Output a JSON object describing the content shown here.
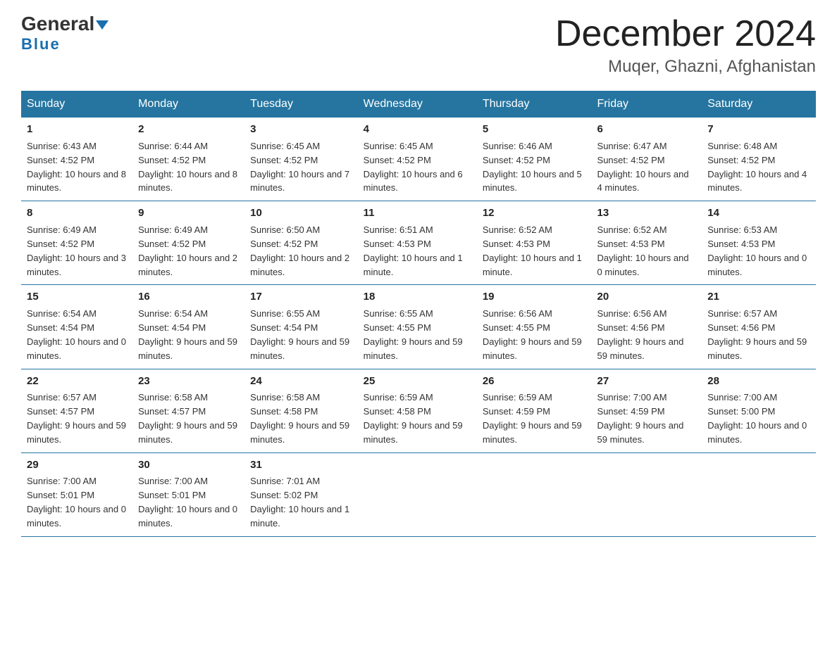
{
  "logo": {
    "general": "General",
    "blue": "Blue"
  },
  "title": "December 2024",
  "subtitle": "Muqer, Ghazni, Afghanistan",
  "days_header": [
    "Sunday",
    "Monday",
    "Tuesday",
    "Wednesday",
    "Thursday",
    "Friday",
    "Saturday"
  ],
  "weeks": [
    [
      {
        "num": "1",
        "sunrise": "6:43 AM",
        "sunset": "4:52 PM",
        "daylight": "10 hours and 8 minutes."
      },
      {
        "num": "2",
        "sunrise": "6:44 AM",
        "sunset": "4:52 PM",
        "daylight": "10 hours and 8 minutes."
      },
      {
        "num": "3",
        "sunrise": "6:45 AM",
        "sunset": "4:52 PM",
        "daylight": "10 hours and 7 minutes."
      },
      {
        "num": "4",
        "sunrise": "6:45 AM",
        "sunset": "4:52 PM",
        "daylight": "10 hours and 6 minutes."
      },
      {
        "num": "5",
        "sunrise": "6:46 AM",
        "sunset": "4:52 PM",
        "daylight": "10 hours and 5 minutes."
      },
      {
        "num": "6",
        "sunrise": "6:47 AM",
        "sunset": "4:52 PM",
        "daylight": "10 hours and 4 minutes."
      },
      {
        "num": "7",
        "sunrise": "6:48 AM",
        "sunset": "4:52 PM",
        "daylight": "10 hours and 4 minutes."
      }
    ],
    [
      {
        "num": "8",
        "sunrise": "6:49 AM",
        "sunset": "4:52 PM",
        "daylight": "10 hours and 3 minutes."
      },
      {
        "num": "9",
        "sunrise": "6:49 AM",
        "sunset": "4:52 PM",
        "daylight": "10 hours and 2 minutes."
      },
      {
        "num": "10",
        "sunrise": "6:50 AM",
        "sunset": "4:52 PM",
        "daylight": "10 hours and 2 minutes."
      },
      {
        "num": "11",
        "sunrise": "6:51 AM",
        "sunset": "4:53 PM",
        "daylight": "10 hours and 1 minute."
      },
      {
        "num": "12",
        "sunrise": "6:52 AM",
        "sunset": "4:53 PM",
        "daylight": "10 hours and 1 minute."
      },
      {
        "num": "13",
        "sunrise": "6:52 AM",
        "sunset": "4:53 PM",
        "daylight": "10 hours and 0 minutes."
      },
      {
        "num": "14",
        "sunrise": "6:53 AM",
        "sunset": "4:53 PM",
        "daylight": "10 hours and 0 minutes."
      }
    ],
    [
      {
        "num": "15",
        "sunrise": "6:54 AM",
        "sunset": "4:54 PM",
        "daylight": "10 hours and 0 minutes."
      },
      {
        "num": "16",
        "sunrise": "6:54 AM",
        "sunset": "4:54 PM",
        "daylight": "9 hours and 59 minutes."
      },
      {
        "num": "17",
        "sunrise": "6:55 AM",
        "sunset": "4:54 PM",
        "daylight": "9 hours and 59 minutes."
      },
      {
        "num": "18",
        "sunrise": "6:55 AM",
        "sunset": "4:55 PM",
        "daylight": "9 hours and 59 minutes."
      },
      {
        "num": "19",
        "sunrise": "6:56 AM",
        "sunset": "4:55 PM",
        "daylight": "9 hours and 59 minutes."
      },
      {
        "num": "20",
        "sunrise": "6:56 AM",
        "sunset": "4:56 PM",
        "daylight": "9 hours and 59 minutes."
      },
      {
        "num": "21",
        "sunrise": "6:57 AM",
        "sunset": "4:56 PM",
        "daylight": "9 hours and 59 minutes."
      }
    ],
    [
      {
        "num": "22",
        "sunrise": "6:57 AM",
        "sunset": "4:57 PM",
        "daylight": "9 hours and 59 minutes."
      },
      {
        "num": "23",
        "sunrise": "6:58 AM",
        "sunset": "4:57 PM",
        "daylight": "9 hours and 59 minutes."
      },
      {
        "num": "24",
        "sunrise": "6:58 AM",
        "sunset": "4:58 PM",
        "daylight": "9 hours and 59 minutes."
      },
      {
        "num": "25",
        "sunrise": "6:59 AM",
        "sunset": "4:58 PM",
        "daylight": "9 hours and 59 minutes."
      },
      {
        "num": "26",
        "sunrise": "6:59 AM",
        "sunset": "4:59 PM",
        "daylight": "9 hours and 59 minutes."
      },
      {
        "num": "27",
        "sunrise": "7:00 AM",
        "sunset": "4:59 PM",
        "daylight": "9 hours and 59 minutes."
      },
      {
        "num": "28",
        "sunrise": "7:00 AM",
        "sunset": "5:00 PM",
        "daylight": "10 hours and 0 minutes."
      }
    ],
    [
      {
        "num": "29",
        "sunrise": "7:00 AM",
        "sunset": "5:01 PM",
        "daylight": "10 hours and 0 minutes."
      },
      {
        "num": "30",
        "sunrise": "7:00 AM",
        "sunset": "5:01 PM",
        "daylight": "10 hours and 0 minutes."
      },
      {
        "num": "31",
        "sunrise": "7:01 AM",
        "sunset": "5:02 PM",
        "daylight": "10 hours and 1 minute."
      },
      null,
      null,
      null,
      null
    ]
  ],
  "labels": {
    "sunrise": "Sunrise:",
    "sunset": "Sunset:",
    "daylight": "Daylight:"
  }
}
